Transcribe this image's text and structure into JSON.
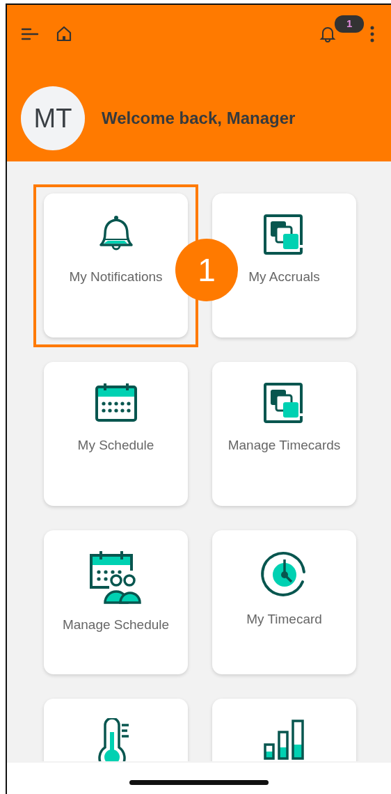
{
  "header": {
    "notification_count": "1",
    "avatar_initials": "MT",
    "welcome": "Welcome back, Manager"
  },
  "tiles": [
    {
      "kind": "bell",
      "label": "My Notifications"
    },
    {
      "kind": "layers",
      "label": "My Accruals"
    },
    {
      "kind": "calendar",
      "label": "My Schedule"
    },
    {
      "kind": "layers",
      "label": "Manage Timecards"
    },
    {
      "kind": "calendar-people",
      "label": "Manage Schedule"
    },
    {
      "kind": "clock",
      "label": "My Timecard"
    },
    {
      "kind": "thermometer"
    },
    {
      "kind": "chart"
    }
  ],
  "callout": {
    "number": "1"
  }
}
